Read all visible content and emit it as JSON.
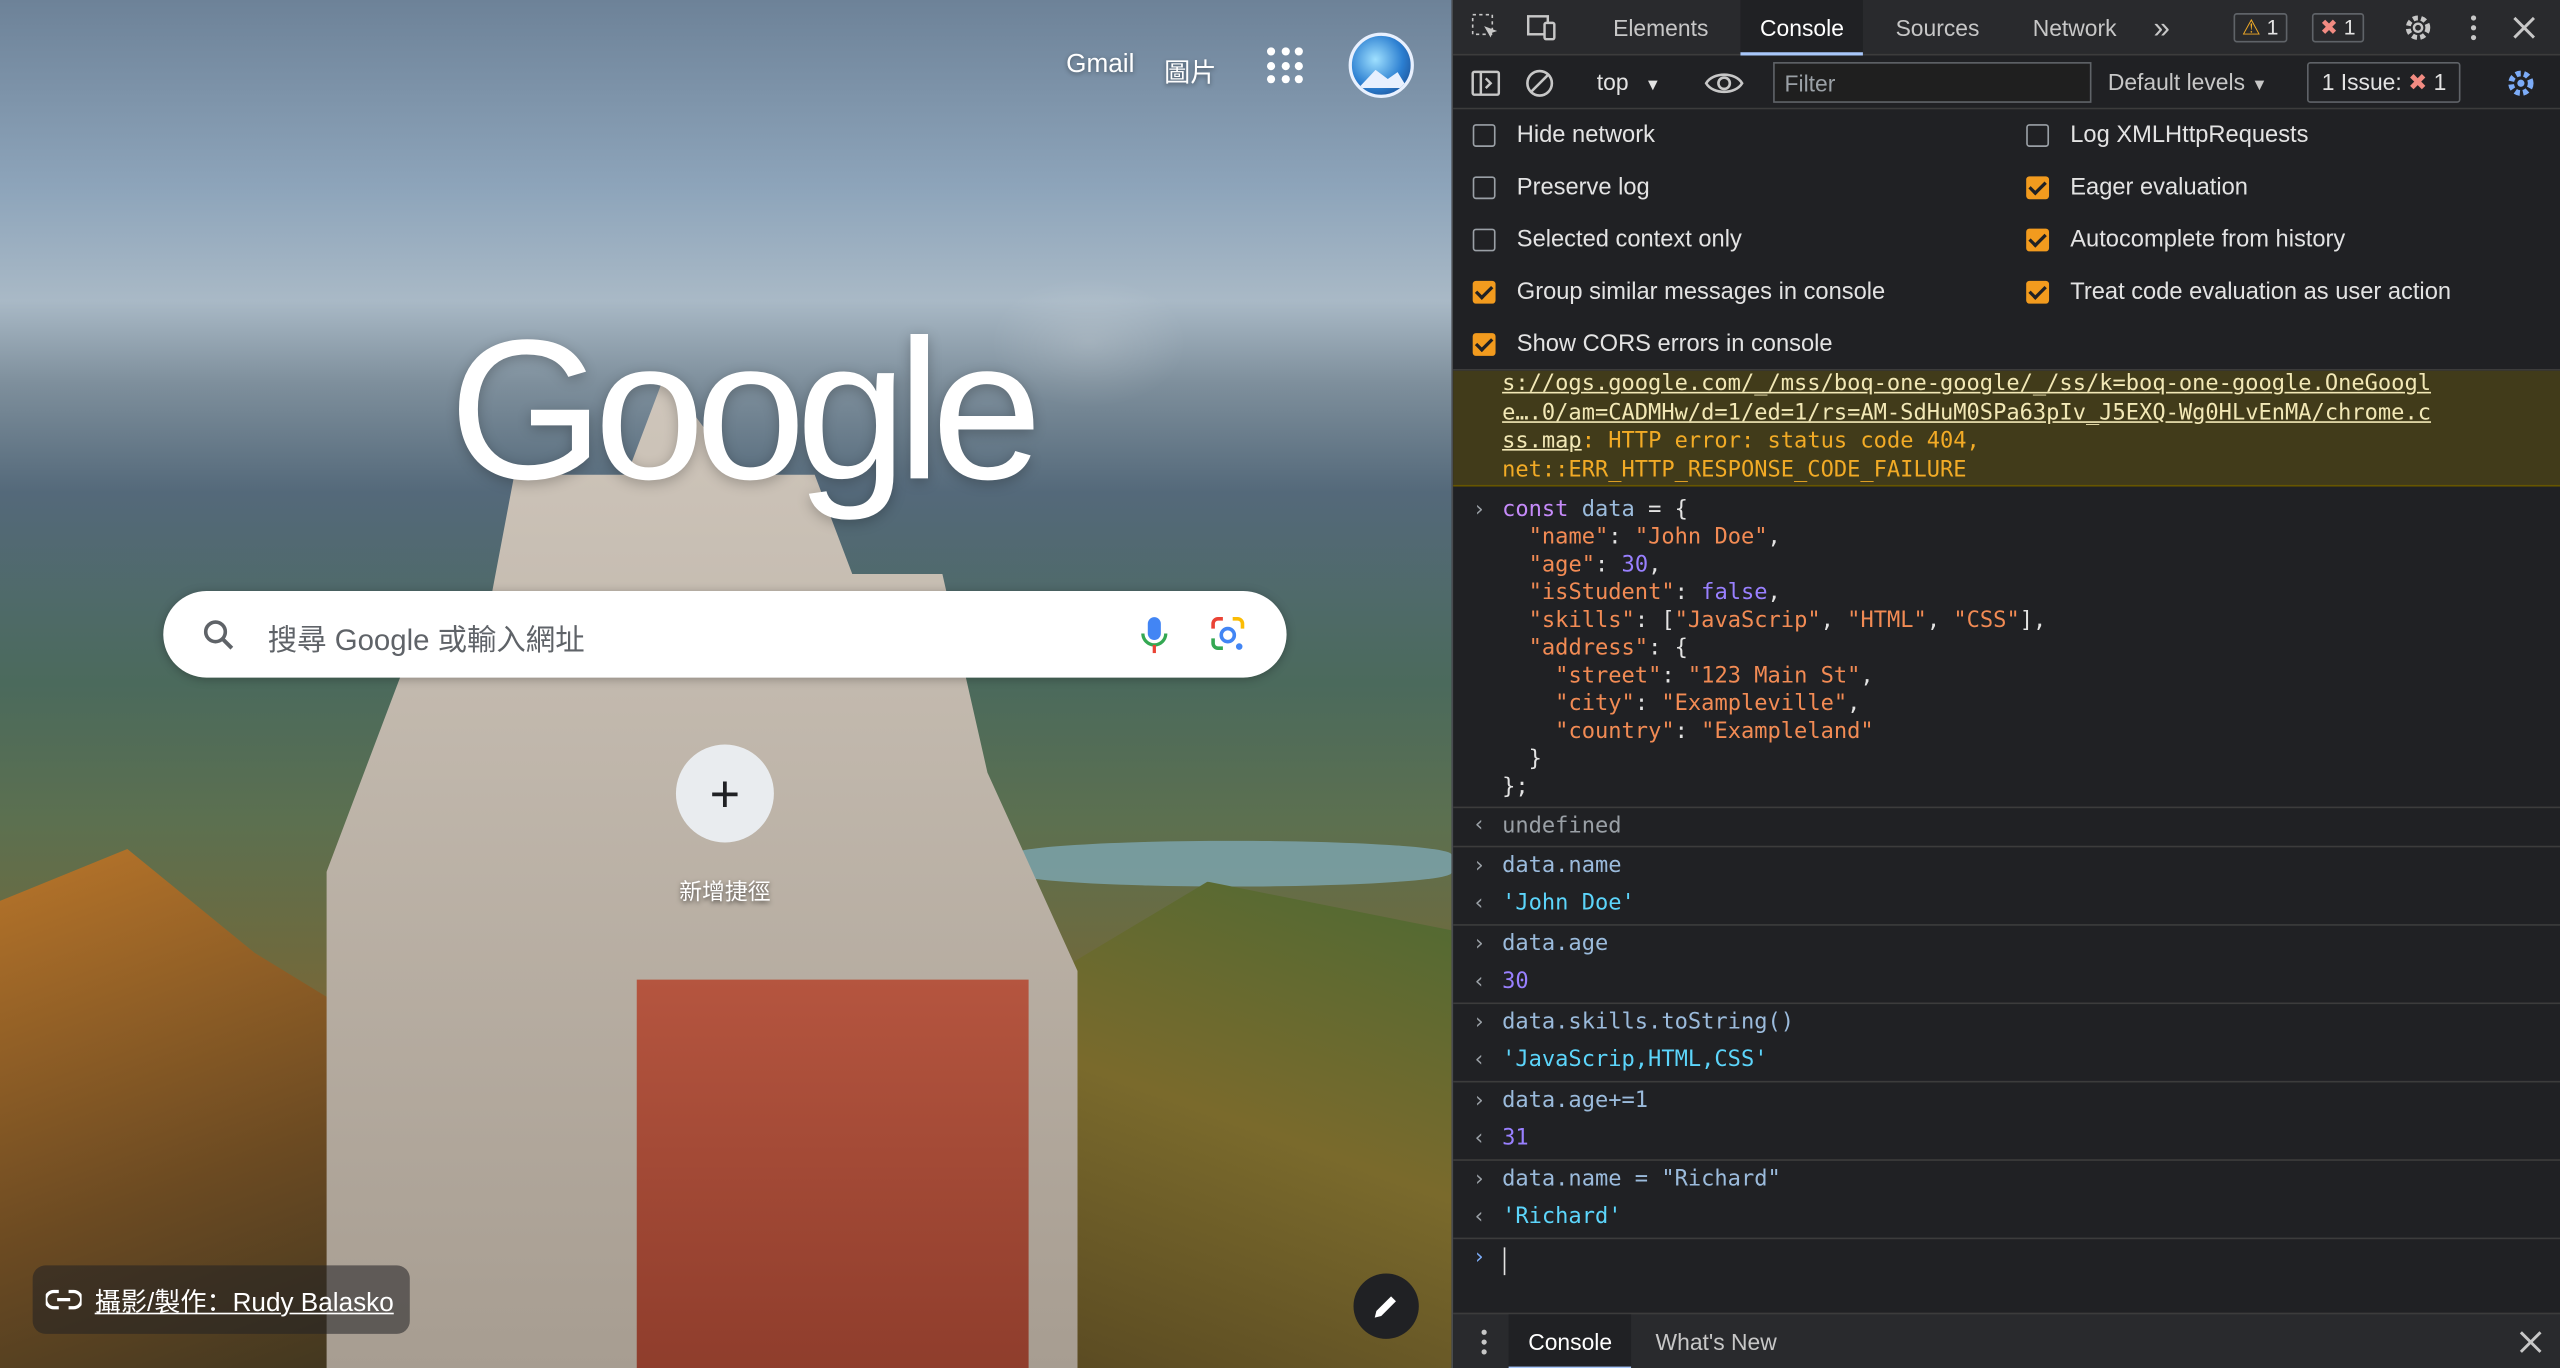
{
  "ntp": {
    "links": {
      "gmail": "Gmail",
      "images": "圖片"
    },
    "logo": "Google",
    "search_placeholder": "搜尋 Google 或輸入網址",
    "shortcut_label": "新增捷徑",
    "credit": "攝影/製作：Rudy Balasko"
  },
  "devtools": {
    "tabs": [
      "Elements",
      "Console",
      "Sources",
      "Network"
    ],
    "active_tab": "Console",
    "warning_count": "1",
    "error_count": "1",
    "context": "top",
    "filter_placeholder": "Filter",
    "levels": "Default levels",
    "issues_label": "1 Issue:",
    "issues_count": "1",
    "settings_left": [
      "Hide network",
      "Preserve log",
      "Selected context only",
      "Group similar messages in console",
      "Show CORS errors in console"
    ],
    "settings_left_checked": [
      false,
      false,
      false,
      true,
      true
    ],
    "settings_right": [
      "Log XMLHttpRequests",
      "Eager evaluation",
      "Autocomplete from history",
      "Treat code evaluation as user action"
    ],
    "settings_right_checked": [
      false,
      true,
      true,
      true
    ],
    "warning": {
      "url_line1": "s://ogs.google.com/_/mss/boq-one-google/_/ss/k=boq-one-google.OneGoogl",
      "url_line2": "e….0/am=CADMHw/d=1/ed=1/rs=AM-SdHuM0SPa63pIv_J5EXQ-Wg0HLvEnMA/chrome.c",
      "url_line3": "ss.map",
      "msg_line3": ": HTTP error: status code 404,",
      "msg_line4": "net::ERR_HTTP_RESPONSE_CODE_FAILURE"
    },
    "console_entries": [
      {
        "input": "data.name",
        "output": "'John Doe'"
      },
      {
        "input": "data.age",
        "output": "30"
      },
      {
        "input": "data.skills.toString()",
        "output": "'JavaScrip,HTML,CSS'"
      },
      {
        "input": "data.age+=1",
        "output": "31"
      },
      {
        "input": "data.name = \"Richard\"",
        "output": "'Richard'"
      }
    ],
    "undefined_result": "undefined",
    "drawer_tabs": [
      "Console",
      "What's New"
    ]
  }
}
